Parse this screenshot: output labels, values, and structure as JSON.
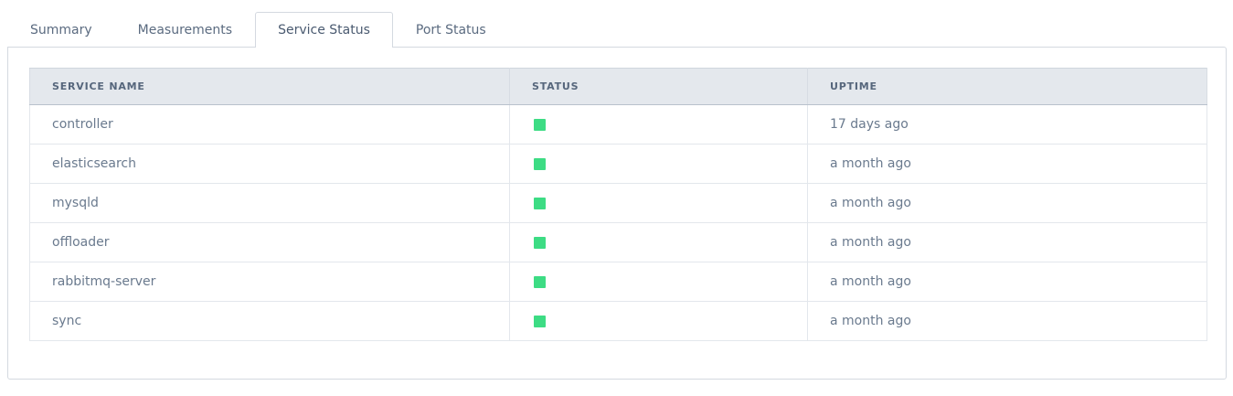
{
  "tabs": [
    {
      "label": "Summary",
      "active": false
    },
    {
      "label": "Measurements",
      "active": false
    },
    {
      "label": "Service Status",
      "active": true
    },
    {
      "label": "Port Status",
      "active": false
    }
  ],
  "table": {
    "columns": [
      "SERVICE NAME",
      "STATUS",
      "UPTIME"
    ],
    "rows": [
      {
        "service": "controller",
        "status": "running",
        "uptime": "17 days ago"
      },
      {
        "service": "elasticsearch",
        "status": "running",
        "uptime": "a month ago"
      },
      {
        "service": "mysqld",
        "status": "running",
        "uptime": "a month ago"
      },
      {
        "service": "offloader",
        "status": "running",
        "uptime": "a month ago"
      },
      {
        "service": "rabbitmq-server",
        "status": "running",
        "uptime": "a month ago"
      },
      {
        "service": "sync",
        "status": "running",
        "uptime": "a month ago"
      }
    ]
  },
  "colors": {
    "status_ok": "#3ddc84",
    "header_bg": "#e4e8ed"
  }
}
